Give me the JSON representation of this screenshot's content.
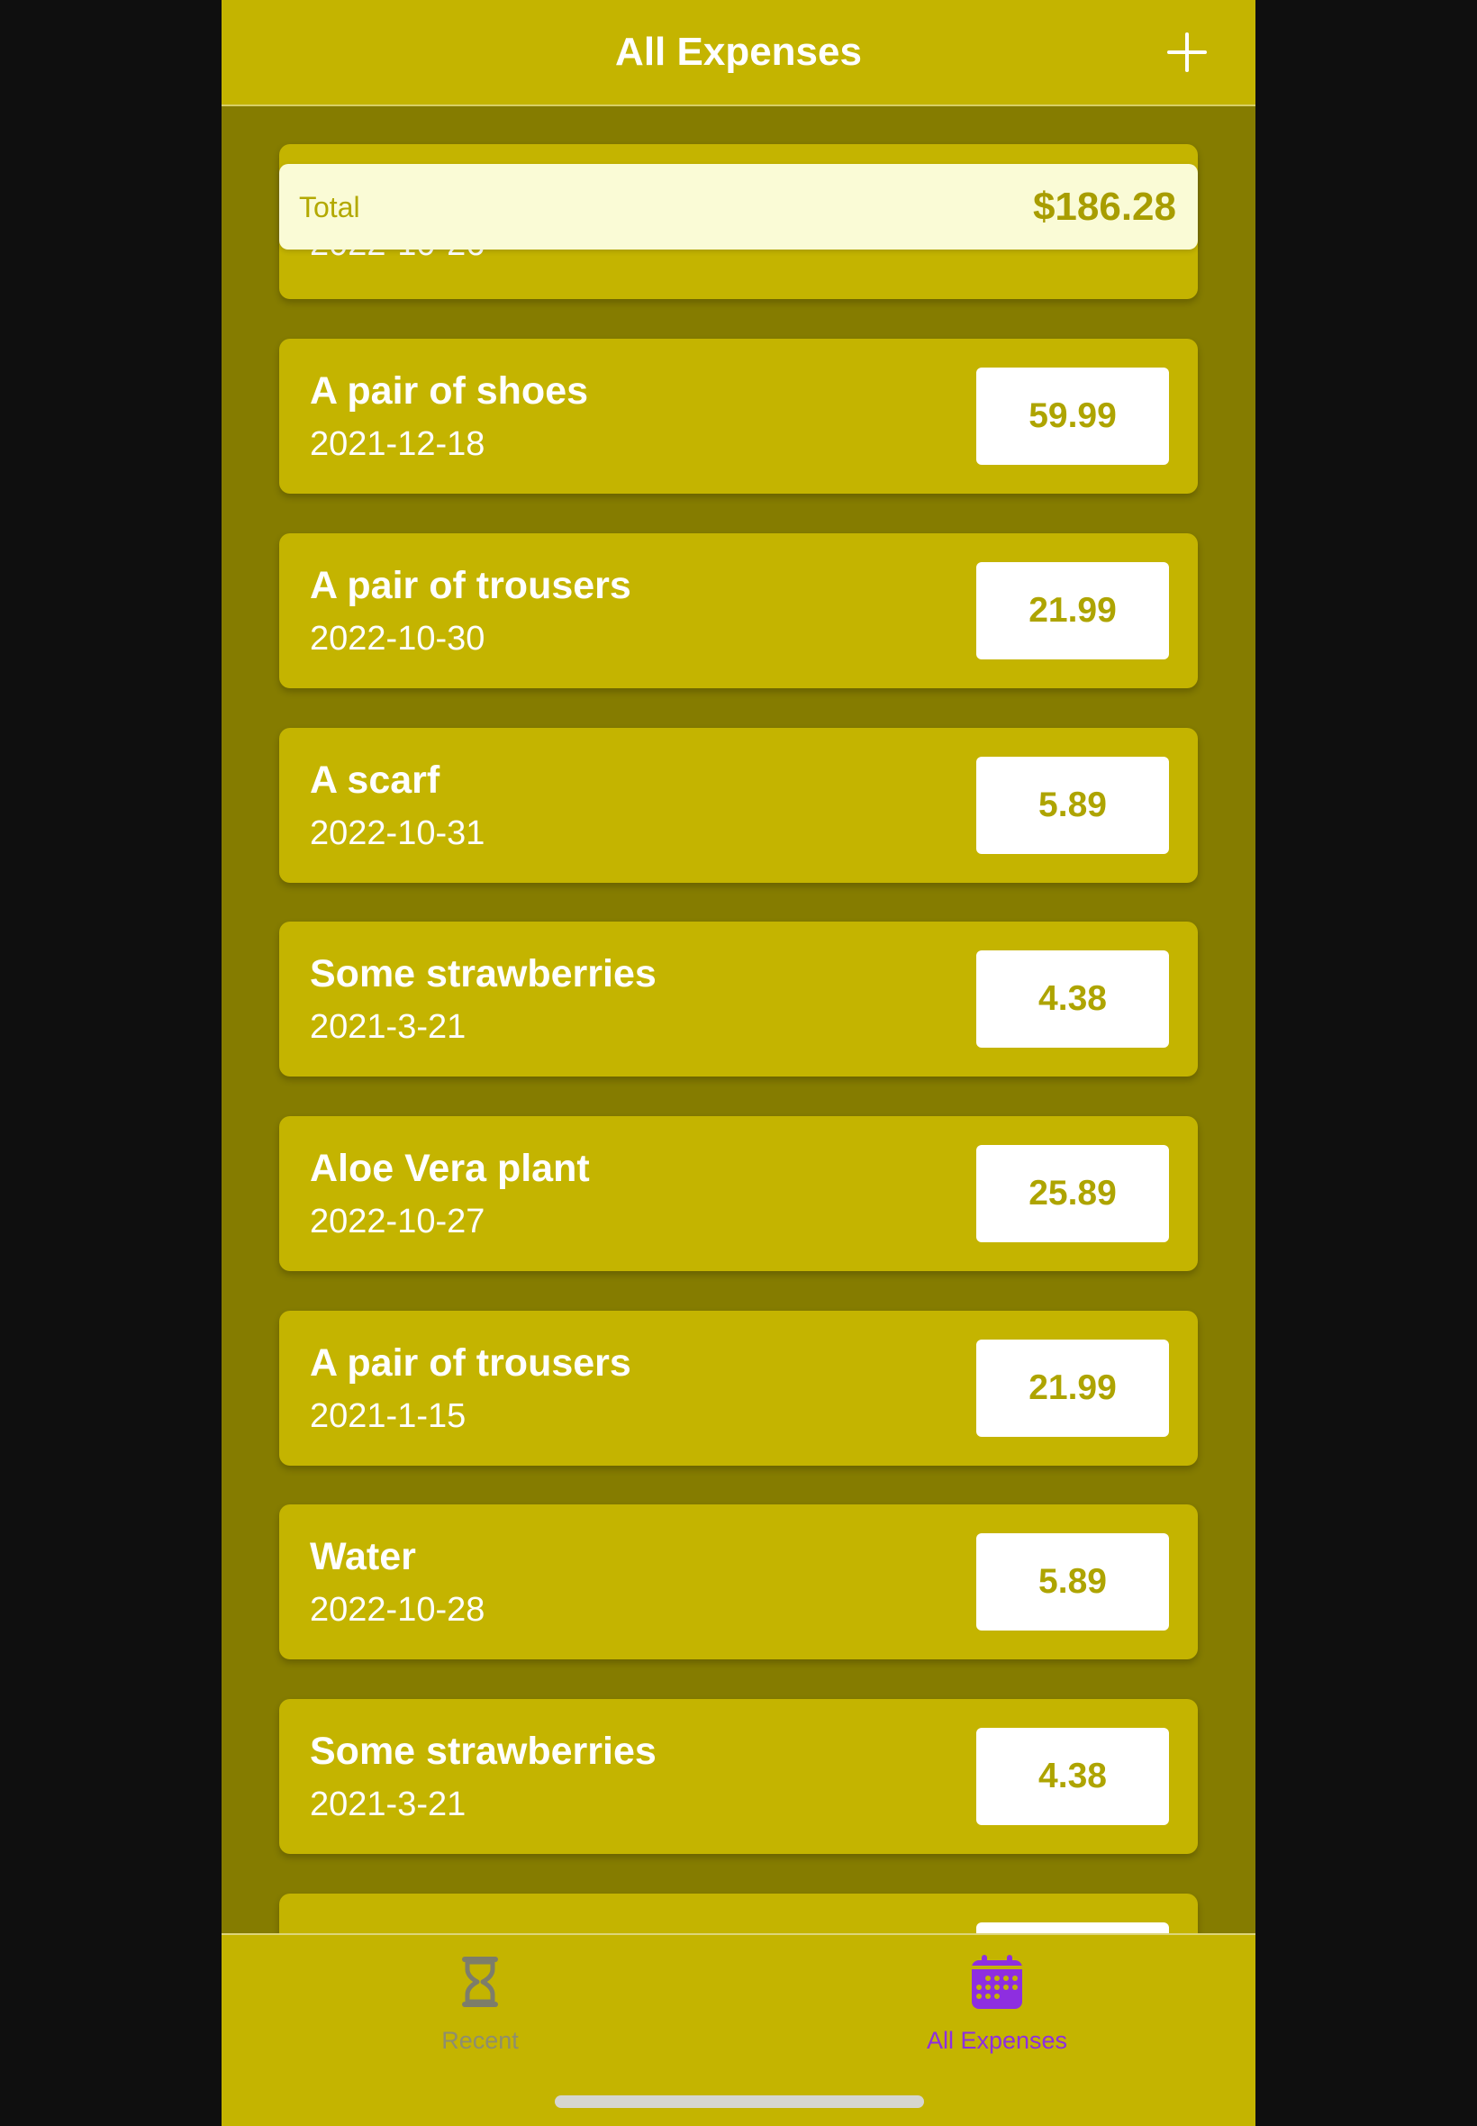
{
  "header": {
    "title": "All Expenses",
    "add_icon": "plus-icon"
  },
  "summary": {
    "label": "Total",
    "value": "$186.28"
  },
  "partial_top_item": {
    "date": "2022-10-26"
  },
  "expenses": [
    {
      "title": "A pair of shoes",
      "date": "2021-12-18",
      "amount": "59.99"
    },
    {
      "title": "A pair of trousers",
      "date": "2022-10-30",
      "amount": "21.99"
    },
    {
      "title": "A scarf",
      "date": "2022-10-31",
      "amount": "5.89"
    },
    {
      "title": "Some strawberries",
      "date": "2021-3-21",
      "amount": "4.38"
    },
    {
      "title": "Aloe Vera plant",
      "date": "2022-10-27",
      "amount": "25.89"
    },
    {
      "title": "A pair of trousers",
      "date": "2021-1-15",
      "amount": "21.99"
    },
    {
      "title": "Water",
      "date": "2022-10-28",
      "amount": "5.89"
    },
    {
      "title": "Some strawberries",
      "date": "2021-3-21",
      "amount": "4.38"
    }
  ],
  "tabs": [
    {
      "label": "Recent",
      "icon": "hourglass-icon",
      "active": false
    },
    {
      "label": "All Expenses",
      "icon": "calendar-icon",
      "active": true
    }
  ],
  "colors": {
    "primary": "#c4b400",
    "background": "#857c00",
    "summary_bg": "#fafbd6",
    "accent_active": "#8e2ee0",
    "inactive": "#8a8a6a"
  }
}
